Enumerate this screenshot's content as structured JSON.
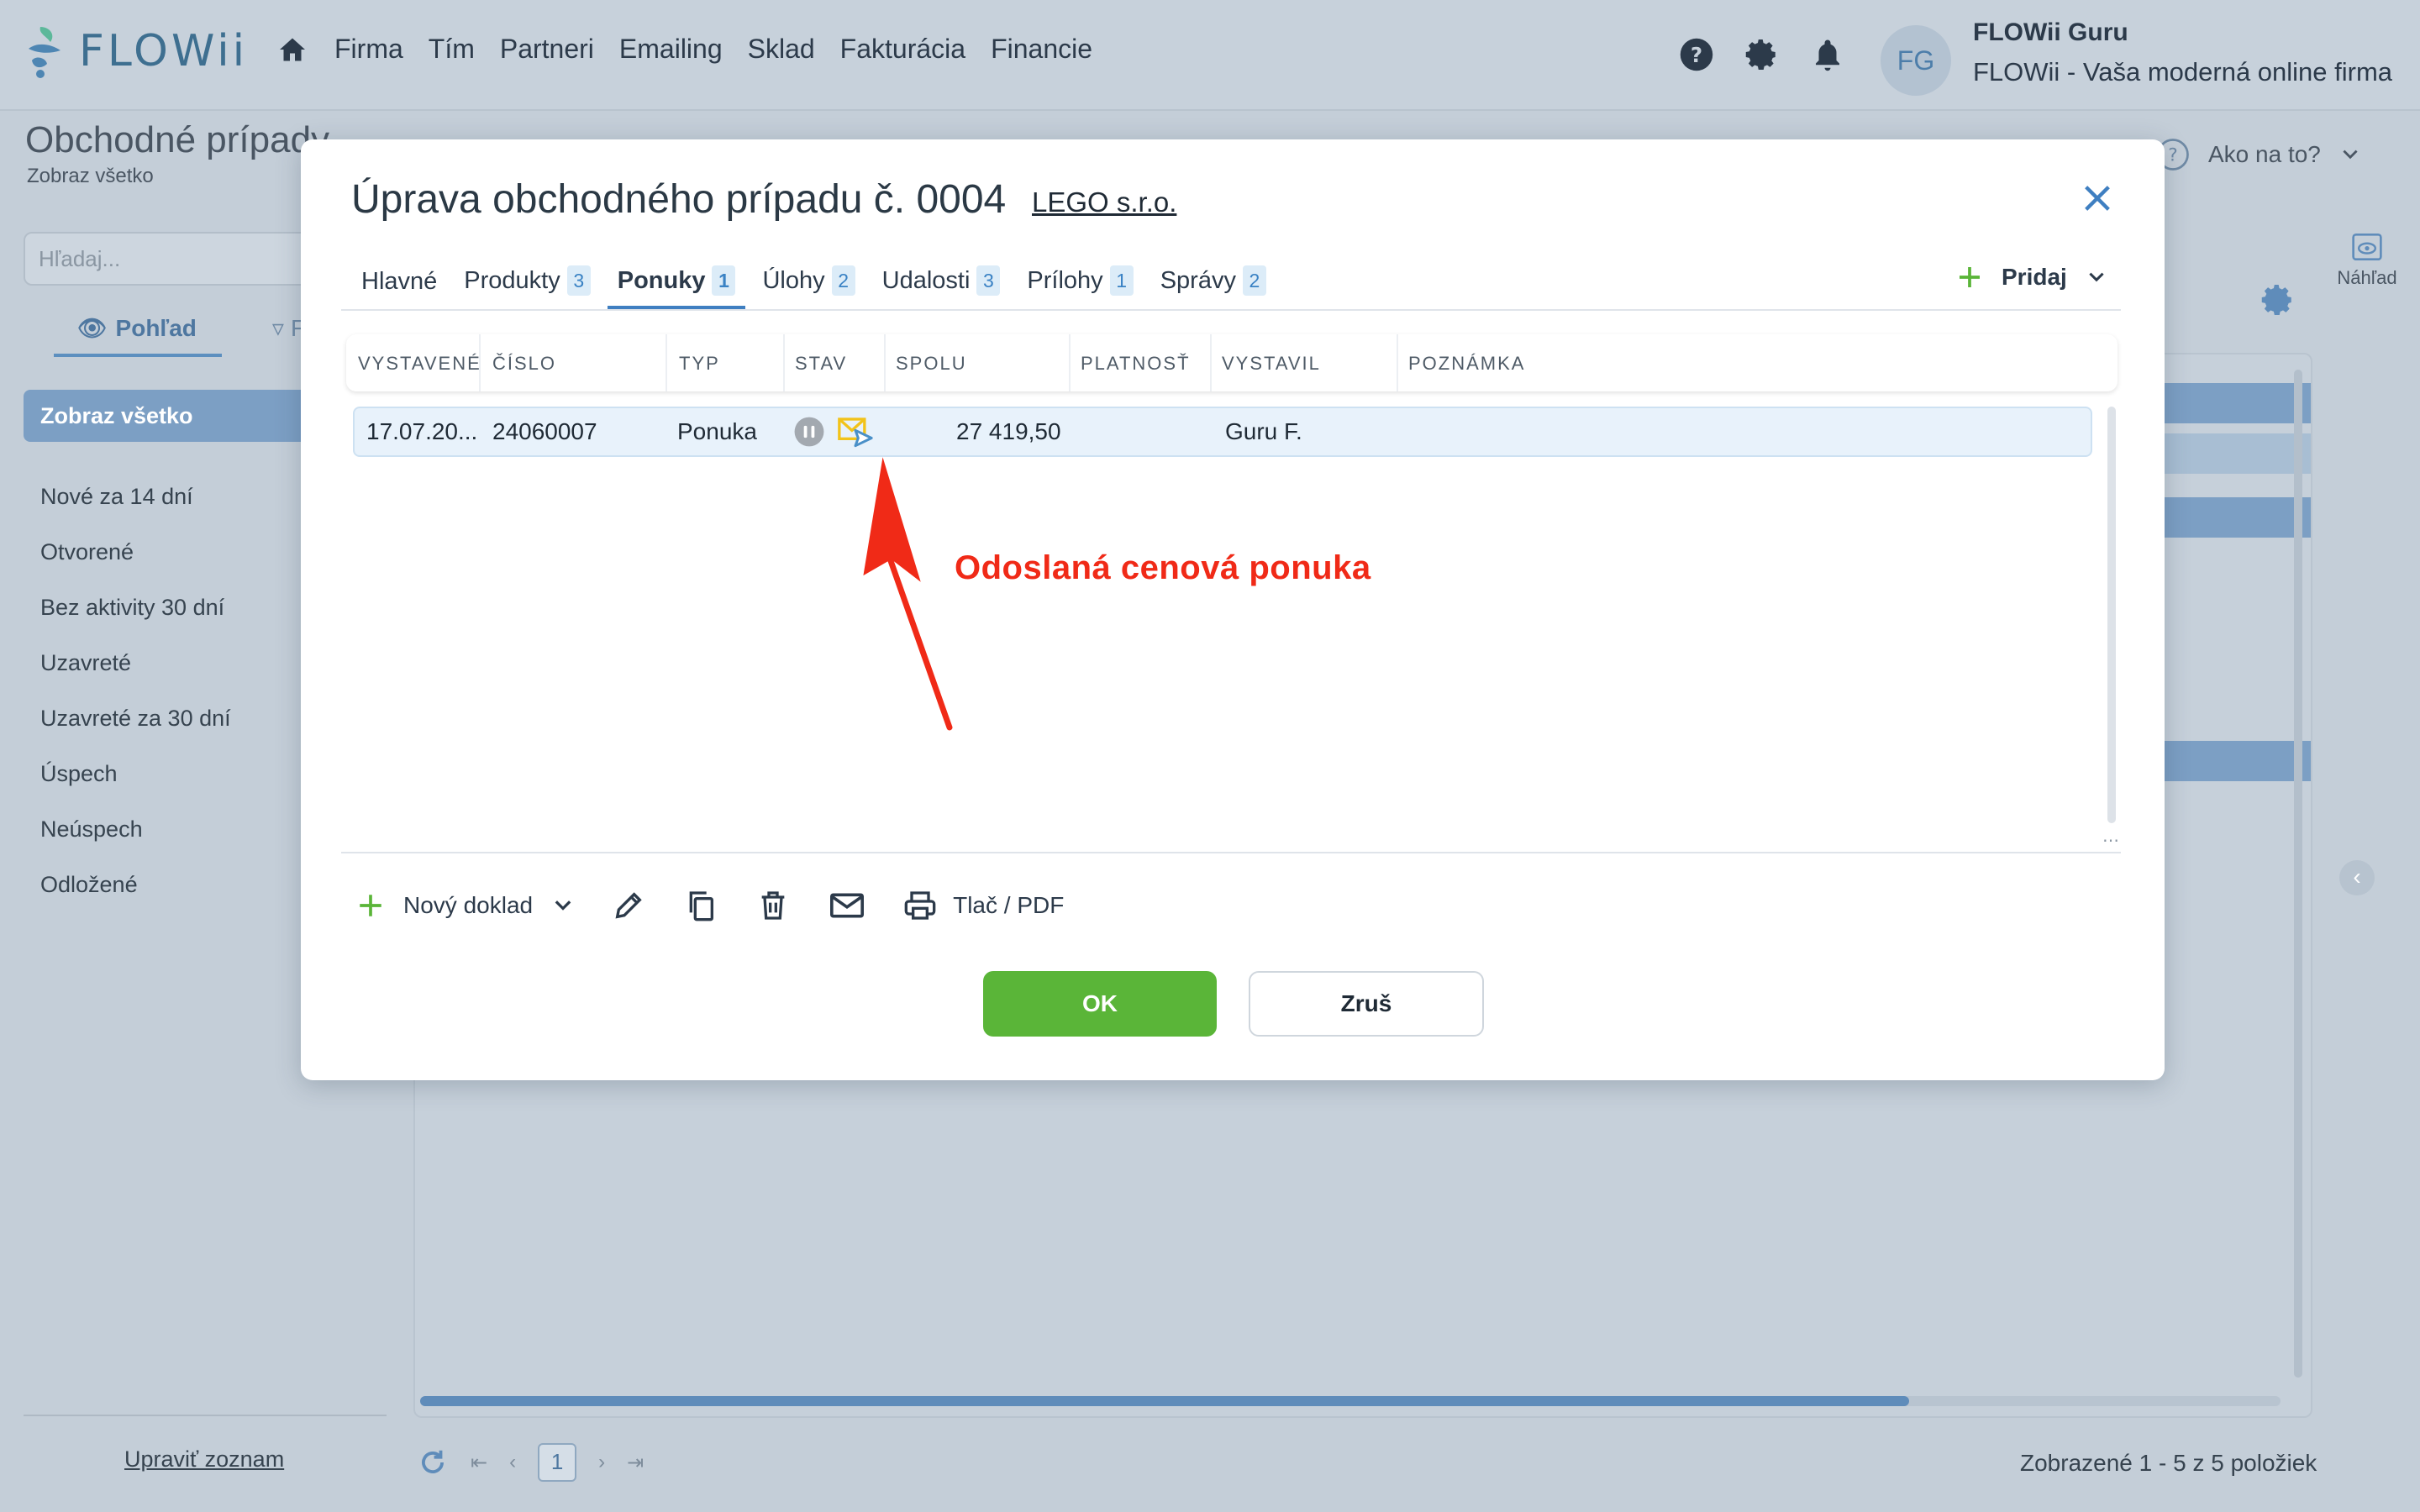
{
  "app": {
    "logo_text": "FLOWii",
    "nav": [
      "Firma",
      "Tím",
      "Partneri",
      "Emailing",
      "Sklad",
      "Fakturácia",
      "Financie"
    ],
    "user": {
      "initials": "FG",
      "name": "FLOWii Guru",
      "subtitle": "FLOWii - Vaša moderná online firma"
    },
    "help_label": "Ako na to?"
  },
  "page": {
    "title": "Obchodné prípady",
    "subtitle": "Zobraz všetko",
    "search_placeholder": "Hľadaj...",
    "view_tab_active": "Pohľad",
    "view_tab_other": "Filter",
    "sidebar_active": "Zobraz všetko",
    "sidebar_items": [
      "Nové za 14 dní",
      "Otvorené",
      "Bez aktivity 30 dní",
      "Uzavreté",
      "Uzavreté za 30 dní",
      "Úspech",
      "Neúspech",
      "Odložené"
    ],
    "edit_list": "Upraviť zoznam",
    "preview_label": "Náhľad",
    "pager_page": "1",
    "pager_info": "Zobrazené 1 - 5 z 5 položiek"
  },
  "modal": {
    "title": "Úprava obchodného prípadu č. 0004",
    "company": "LEGO s.r.o.",
    "tabs": [
      {
        "label": "Hlavné",
        "count": ""
      },
      {
        "label": "Produkty",
        "count": "3"
      },
      {
        "label": "Ponuky",
        "count": "1"
      },
      {
        "label": "Úlohy",
        "count": "2"
      },
      {
        "label": "Udalosti",
        "count": "3"
      },
      {
        "label": "Prílohy",
        "count": "1"
      },
      {
        "label": "Správy",
        "count": "2"
      }
    ],
    "add_label": "Pridaj",
    "columns": [
      "VYSTAVENÉ",
      "ČÍSLO",
      "TYP",
      "STAV",
      "SPOLU",
      "PLATNOSŤ",
      "VYSTAVIL",
      "POZNÁMKA"
    ],
    "rows": [
      {
        "vystavene": "17.07.20...",
        "cislo": "24060007",
        "typ": "Ponuka",
        "spolu": "27 419,50",
        "platnost": "",
        "vystavil": "Guru F.",
        "poznamka": ""
      }
    ],
    "annotation": "Odoslaná cenová ponuka",
    "toolbar": {
      "new_doc": "Nový doklad",
      "print": "Tlač / PDF"
    },
    "ok": "OK",
    "cancel": "Zruš"
  },
  "colors": {
    "accent": "#3f7fc1",
    "ok_green": "#5ab538",
    "annotation_red": "#f02a17",
    "envelope_yellow": "#f2c31a"
  }
}
